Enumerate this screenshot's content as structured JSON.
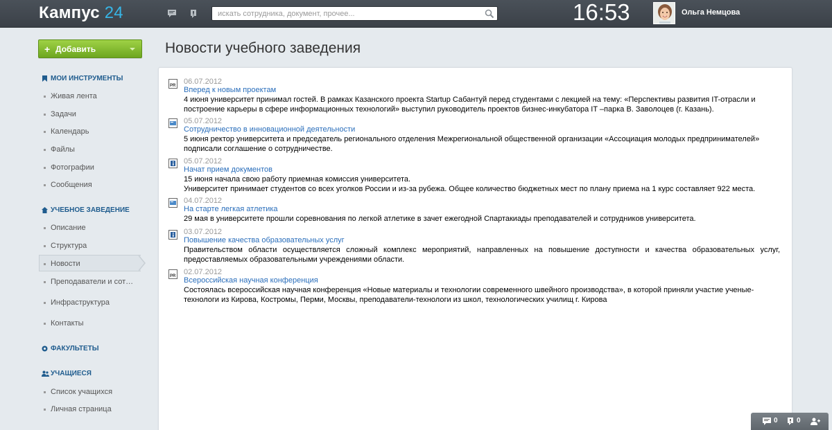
{
  "header": {
    "logo_text": "Кампус",
    "logo_num": "24",
    "search_placeholder": "искать сотрудника, документ, прочее...",
    "clock": "16:53",
    "user_name": "Ольга Немцова"
  },
  "sidebar": {
    "add_label": "Добавить",
    "sections": [
      {
        "title": "МОИ ИНСТРУМЕНТЫ"
      },
      {
        "title": "УЧЕБНОЕ ЗАВЕДЕНИЕ"
      },
      {
        "title": "ФАКУЛЬТЕТЫ"
      },
      {
        "title": "УЧАЩИЕСЯ"
      }
    ],
    "tools": [
      "Живая лента",
      "Задачи",
      "Календарь",
      "Файлы",
      "Фотографии",
      "Сообщения"
    ],
    "school": [
      "Описание",
      "Структура",
      "Новости",
      "Преподаватели и сотрудники",
      "Инфраструктура",
      "Контакты"
    ],
    "students": [
      "Список учащихся",
      "Личная страница"
    ]
  },
  "main": {
    "title": "Новости учебного заведения",
    "news": [
      {
        "date": "06.07.2012",
        "title": "Вперед к новым проектам",
        "text": "4 июня университет принимал гостей. В рамках Казанского проекта Startup Сабантуй перед студентами с лекцией на тему: «Перспективы развития IT-отрасли и построение карьеры в сфере информационных технологий» выступил руководитель проектов бизнес-инкубатора IT –парка В. Заволоцев (г. Казань)."
      },
      {
        "date": "05.07.2012",
        "title": "Сотрудничество в инновационной деятельности",
        "text": "5 июня ректор университета и председатель регионального отделения Межрегиональной общественной организации «Ассоциация молодых предпринимателей» подписали соглашение о сотрудничестве."
      },
      {
        "date": "05.07.2012",
        "title": "Начат прием документов",
        "text": "15 июня начала свою работу приемная комиссия университета.",
        "text2": "Университет принимает студентов со всех уголков России и из-за рубежа. Общее количество бюджетных мест по плану приема на 1 курс составляет 922 места."
      },
      {
        "date": "04.07.2012",
        "title": "На старте легкая атлетика",
        "text": "29 мая в университете прошли соревнования по легкой атлетике в зачет ежегодной Спартакиады преподавателей и сотрудников университета."
      },
      {
        "date": "03.07.2012",
        "title": "Повышение качества образовательных услуг",
        "text": "Правительством области осуществляется сложный комплекс мероприятий, направленных на повышение доступности и качества образовательных услуг, предоставляемых образовательными учреждениями области."
      },
      {
        "date": "02.07.2012",
        "title": "Всероссийская научная конференция",
        "text": "Состоялась всероссийская научная конференция «Новые материалы и технологии современного швейного производства», в которой приняли участие ученые-технологи из Кирова, Костромы, Перми, Москвы, преподаватели-технологи из школ, технологических училищ г. Кирова"
      }
    ]
  },
  "bottombar": {
    "messages_count": "0",
    "alerts_count": "0"
  },
  "colors": {
    "header": "#40464d",
    "accent_blue": "#37b5e6",
    "link": "#2a6ebb",
    "add_green": "#7fb82c"
  },
  "icons": {
    "news_types": [
      "pr-icon",
      "presentation-icon",
      "info-icon",
      "presentation-icon",
      "info-icon",
      "pr-icon"
    ]
  }
}
